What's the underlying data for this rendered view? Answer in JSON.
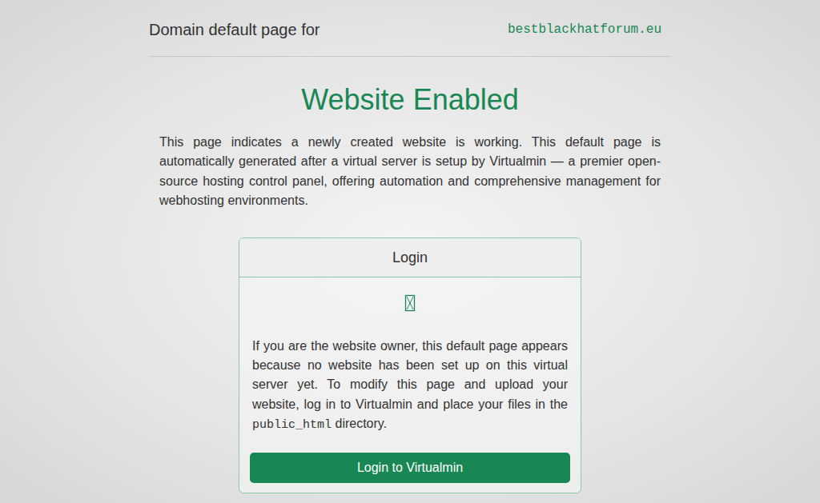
{
  "header": {
    "prefix": "Domain default page for",
    "domain": "bestblackhatforum.eu"
  },
  "title": "Website Enabled",
  "intro": "This page indicates a newly created website is working. This default page is automatically generated after a virtual server is setup by Virtualmin — a premier open-source hosting control panel, offering automation and comprehensive management for webhosting environments.",
  "card": {
    "title": "Login",
    "text_before": "If you are the website owner, this default page appears because no website has been set up on this virtual server yet. To modify this page and upload your website, log in to Virtualmin and place your files in the ",
    "code": "public_html",
    "text_after": " directory.",
    "button": "Login to Virtualmin"
  }
}
